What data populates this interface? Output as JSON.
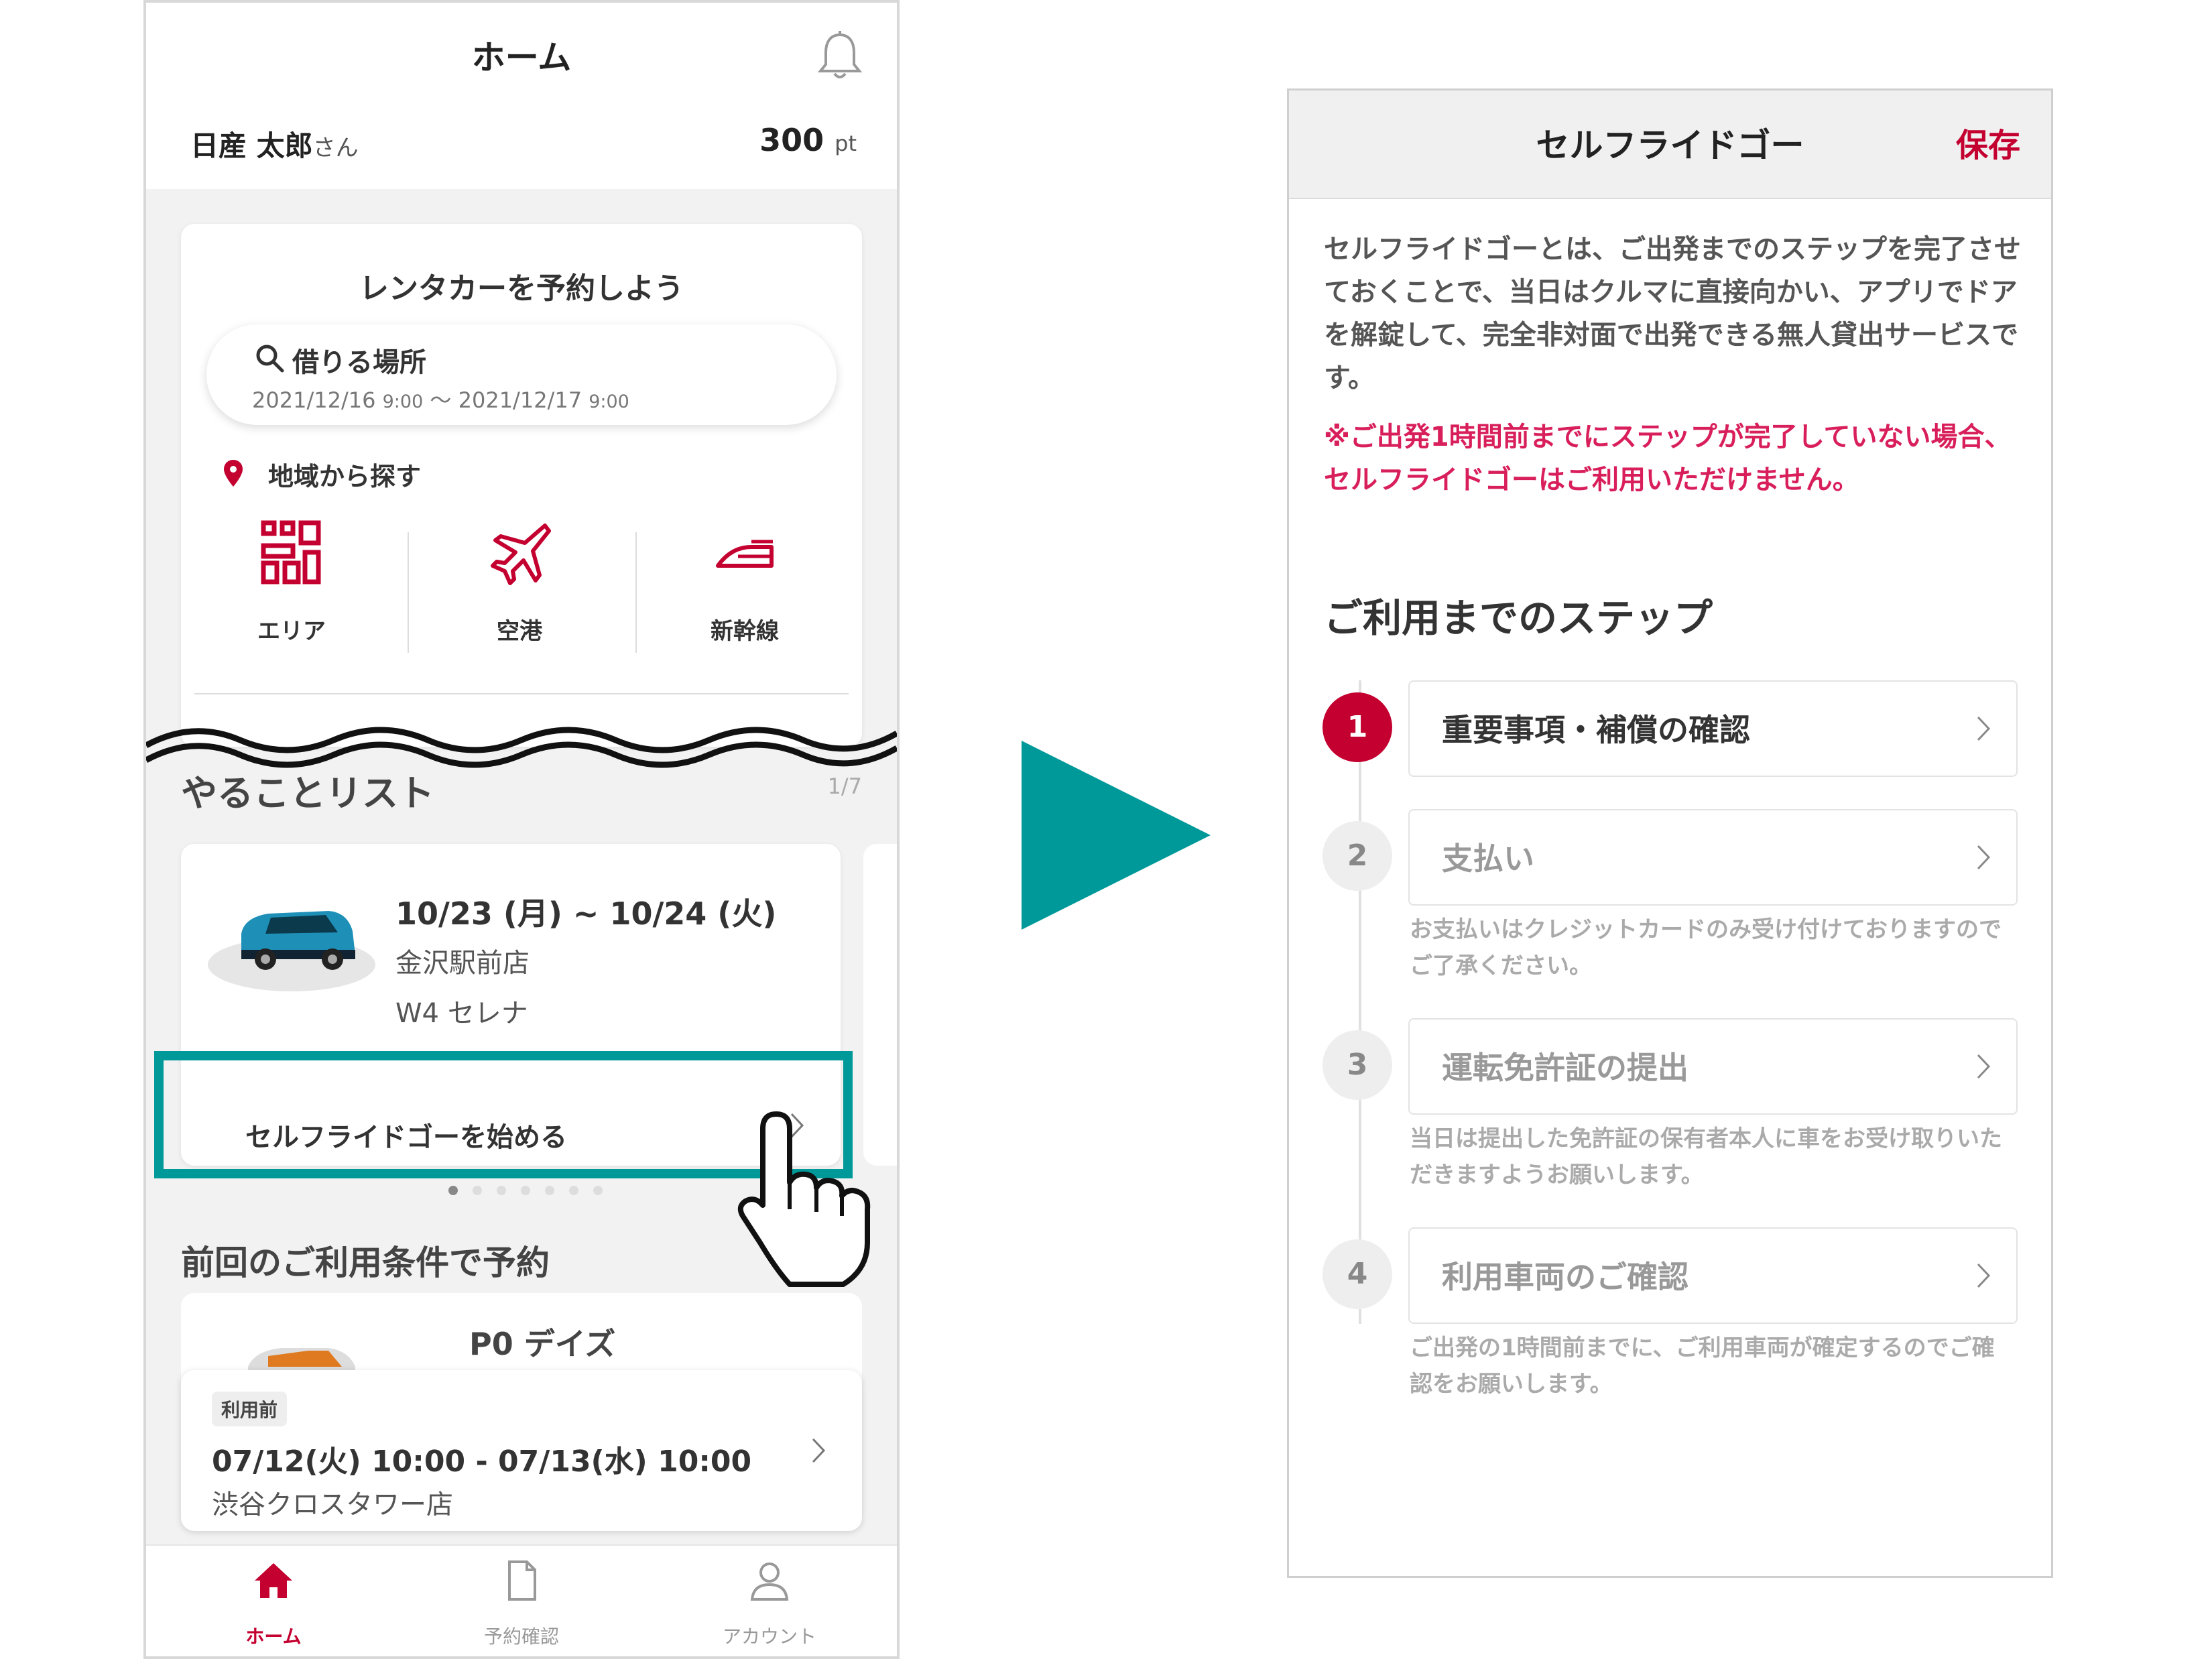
{
  "left_screen": {
    "header": {
      "title": "ホーム",
      "user_name": "日産 太郎",
      "user_suffix": "さん",
      "points": "300",
      "points_unit": "pt"
    },
    "reserve_card": {
      "title": "レンタカーを予約しよう",
      "search": {
        "label": "借りる場所",
        "date_from": "2021/12/16",
        "time_from": "9:00",
        "separator": "～",
        "date_to": "2021/12/17",
        "time_to": "9:00"
      },
      "region_label": "地域から探す",
      "categories": [
        {
          "label": "エリア",
          "icon": "area-icon"
        },
        {
          "label": "空港",
          "icon": "airplane-icon"
        },
        {
          "label": "新幹線",
          "icon": "shinkansen-icon"
        }
      ]
    },
    "todo": {
      "title": "やることリスト",
      "count": "1/7",
      "reservation": {
        "dates": "10/23 (月) ~ 10/24 (火)",
        "shop": "金沢駅前店",
        "model": "W4 セレナ"
      },
      "action_label": "セルフライドゴーを始める"
    },
    "previous": {
      "title": "前回のご利用条件で予約",
      "model": "P0 デイズ",
      "booking": {
        "badge": "利用前",
        "dates": "07/12(火) 10:00 - 07/13(水) 10:00",
        "shop": "渋谷クロスタワー店"
      }
    },
    "tabs": [
      {
        "label": "ホーム",
        "icon": "home-icon"
      },
      {
        "label": "予約確認",
        "icon": "document-icon"
      },
      {
        "label": "アカウント",
        "icon": "person-icon"
      }
    ]
  },
  "right_screen": {
    "header": {
      "title": "セルフライドゴー",
      "save_label": "保存"
    },
    "description": "セルフライドゴーとは、ご出発までのステップを完了させておくことで、当日はクルマに直接向かい、アプリでドアを解錠して、完全非対面で出発できる無人貸出サービスです。",
    "warning": "※ご出発1時間前までにステップが完了していない場合、セルフライドゴーはご利用いただけません。",
    "steps_title": "ご利用までのステップ",
    "steps": [
      {
        "num": "1",
        "label": "重要事項・補償の確認",
        "note": ""
      },
      {
        "num": "2",
        "label": "支払い",
        "note": "お支払いはクレジットカードのみ受け付けておりますのでご了承ください。"
      },
      {
        "num": "3",
        "label": "運転免許証の提出",
        "note": "当日は提出した免許証の保有者本人に車をお受け取りいただきますようお願いします。"
      },
      {
        "num": "4",
        "label": "利用車両のご確認",
        "note": "ご出発の1時間前までに、ご利用車両が確定するのでご確認をお願いします。"
      }
    ]
  },
  "colors": {
    "brand_red": "#c3002f",
    "highlight_teal": "#009999",
    "warning_pink": "#d81e5b"
  }
}
